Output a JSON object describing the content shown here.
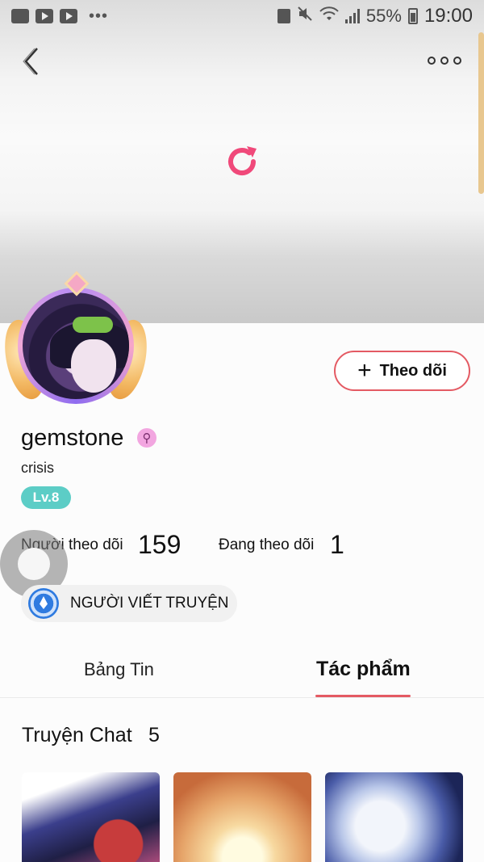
{
  "status_bar": {
    "battery_percent": "55%",
    "time": "19:00",
    "left_icons": [
      "image-icon",
      "youtube-icon",
      "youtube-icon"
    ],
    "right_icons": [
      "battery-saver-icon",
      "mute-icon",
      "wifi-icon",
      "signal-icon",
      "battery-icon"
    ]
  },
  "header": {
    "back_icon": "chevron-left-icon",
    "more_icon": "more-dots-icon",
    "refresh_icon": "refresh-icon",
    "accent_color": "#f0497a"
  },
  "profile": {
    "username": "gemstone",
    "gender_symbol": "⚲",
    "bio": "crisis",
    "level": "Lv.8",
    "follow_button_label": "Theo dõi",
    "followers_label": "Người theo dõi",
    "followers_count": "159",
    "following_label": "Đang theo dõi",
    "following_count": "1",
    "writer_badge_label": "NGƯỜI VIẾT TRUYỆN"
  },
  "tabs": [
    {
      "label": "Bảng Tin",
      "active": false
    },
    {
      "label": "Tác phẩm",
      "active": true
    }
  ],
  "section": {
    "title": "Truyện Chat",
    "count": "5"
  },
  "colors": {
    "tab_indicator": "#e45a63",
    "level_badge": "#5ccdc6",
    "follow_border": "#e45a63"
  }
}
